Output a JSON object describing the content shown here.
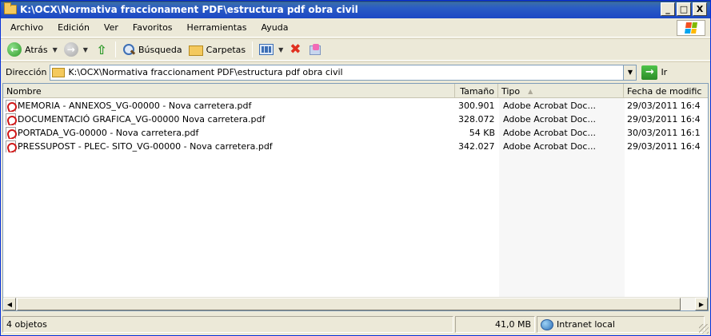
{
  "window": {
    "title": "K:\\OCX\\Normativa fraccionament PDF\\estructura pdf obra civil",
    "buttons": {
      "minimize": "_",
      "maximize": "□",
      "close": "X"
    }
  },
  "menubar": {
    "items": [
      "Archivo",
      "Edición",
      "Ver",
      "Favoritos",
      "Herramientas",
      "Ayuda"
    ]
  },
  "toolbar": {
    "back_label": "Atrás",
    "search_label": "Búsqueda",
    "folders_label": "Carpetas"
  },
  "address": {
    "label": "Dirección",
    "value": "K:\\OCX\\Normativa fraccionament PDF\\estructura pdf obra civil",
    "go_label": "Ir"
  },
  "list": {
    "columns": {
      "name": "Nombre",
      "size": "Tamaño",
      "type": "Tipo",
      "date": "Fecha de modific"
    },
    "files": [
      {
        "name": "MEMORIA - ANNEXOS_VG-00000 - Nova carretera.pdf",
        "size": "300.901 KB",
        "type": "Adobe Acrobat Doc...",
        "date": "29/03/2011 16:4"
      },
      {
        "name": "DOCUMENTACIÓ GRAFICA_VG-00000 Nova carretera.pdf",
        "size": "328.072 KB",
        "type": "Adobe Acrobat Doc...",
        "date": "29/03/2011 16:4"
      },
      {
        "name": "PORTADA_VG-00000 - Nova carretera.pdf",
        "size": "54 KB",
        "type": "Adobe Acrobat Doc...",
        "date": "30/03/2011 16:1"
      },
      {
        "name": "PRESSUPOST - PLEC- SITO_VG-00000 - Nova carretera.pdf",
        "size": "342.027 KB",
        "type": "Adobe Acrobat Doc...",
        "date": "29/03/2011 16:4"
      }
    ]
  },
  "statusbar": {
    "objects": "4 objetos",
    "total_size": "41,0 MB",
    "zone": "Intranet local"
  }
}
